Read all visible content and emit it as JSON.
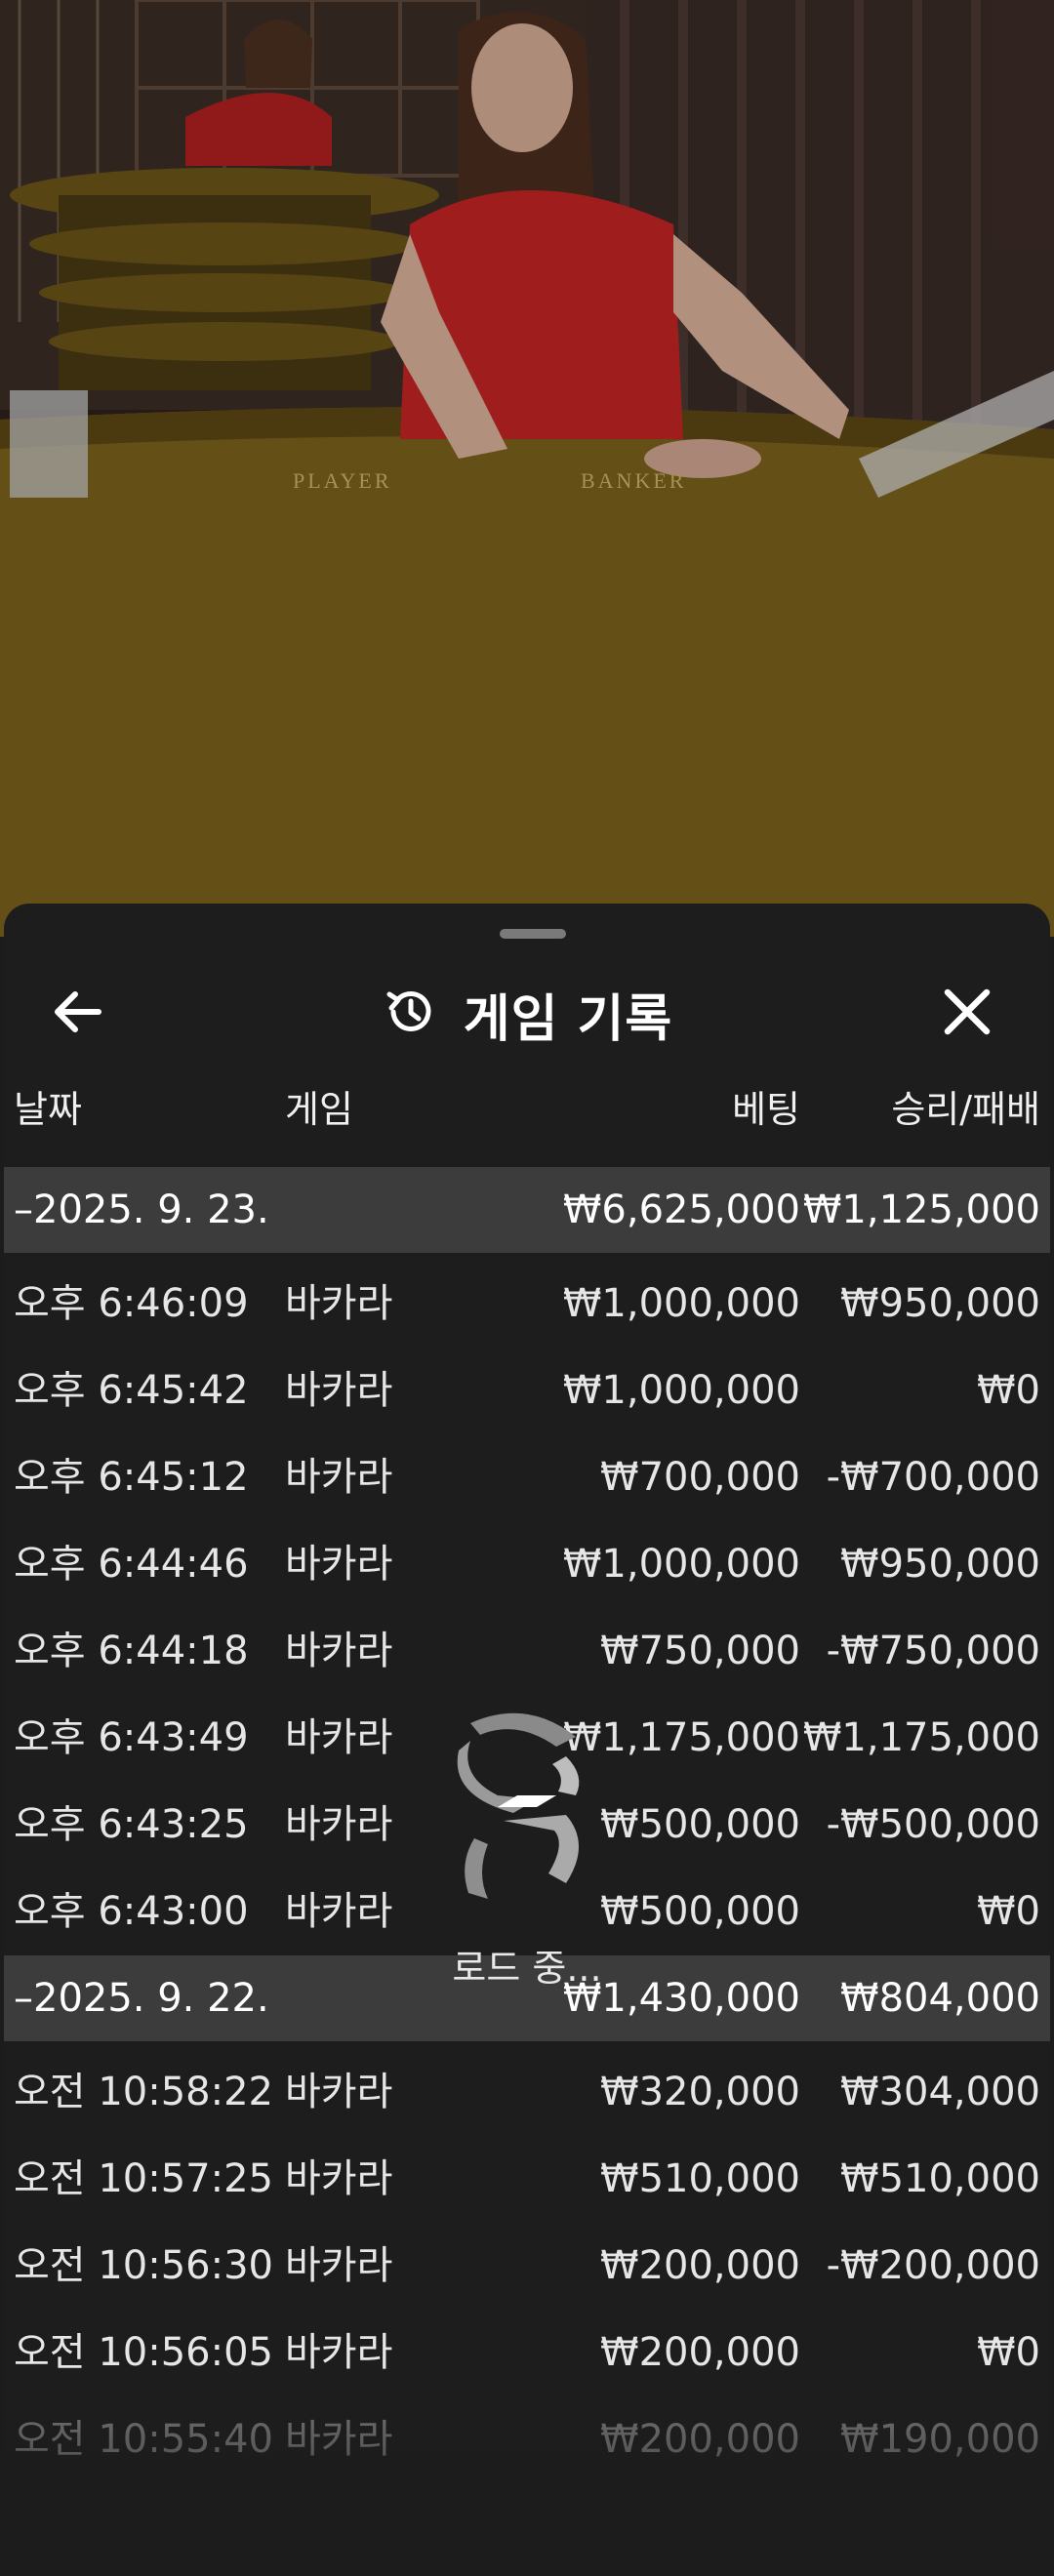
{
  "header": {
    "title": "게임 기록",
    "back_icon": "arrow-left-icon",
    "history_icon": "history-clock-icon",
    "close_icon": "close-icon"
  },
  "columns": {
    "date": "날짜",
    "game": "게임",
    "bet": "베팅",
    "result": "승리/패배"
  },
  "groups": [
    {
      "date": "2025. 9. 23.",
      "bet_total": "₩6,625,000",
      "result_total": "₩1,125,000",
      "rows": [
        {
          "time": "오후 6:46:09",
          "game": "바카라",
          "bet": "₩1,000,000",
          "result": "₩950,000"
        },
        {
          "time": "오후 6:45:42",
          "game": "바카라",
          "bet": "₩1,000,000",
          "result": "₩0"
        },
        {
          "time": "오후 6:45:12",
          "game": "바카라",
          "bet": "₩700,000",
          "result": "-₩700,000"
        },
        {
          "time": "오후 6:44:46",
          "game": "바카라",
          "bet": "₩1,000,000",
          "result": "₩950,000"
        },
        {
          "time": "오후 6:44:18",
          "game": "바카라",
          "bet": "₩750,000",
          "result": "-₩750,000"
        },
        {
          "time": "오후 6:43:49",
          "game": "바카라",
          "bet": "₩1,175,000",
          "result": "₩1,175,000"
        },
        {
          "time": "오후 6:43:25",
          "game": "바카라",
          "bet": "₩500,000",
          "result": "-₩500,000"
        },
        {
          "time": "오후 6:43:00",
          "game": "바카라",
          "bet": "₩500,000",
          "result": "₩0"
        }
      ]
    },
    {
      "date": "2025. 9. 22.",
      "bet_total": "₩1,430,000",
      "result_total": "₩804,000",
      "rows": [
        {
          "time": "오전 10:58:22",
          "game": "바카라",
          "bet": "₩320,000",
          "result": "₩304,000"
        },
        {
          "time": "오전 10:57:25",
          "game": "바카라",
          "bet": "₩510,000",
          "result": "₩510,000"
        },
        {
          "time": "오전 10:56:30",
          "game": "바카라",
          "bet": "₩200,000",
          "result": "-₩200,000"
        },
        {
          "time": "오전 10:56:05",
          "game": "바카라",
          "bet": "₩200,000",
          "result": "₩0"
        },
        {
          "time": "오전 10:55:40",
          "game": "바카라",
          "bet": "₩200,000",
          "result": "₩190,000"
        }
      ]
    }
  ],
  "loader": {
    "text": "로드 중...",
    "icon": "loading-spinner-icon"
  },
  "video": {
    "table_labels": [
      "PLAYER",
      "BANKER"
    ]
  }
}
